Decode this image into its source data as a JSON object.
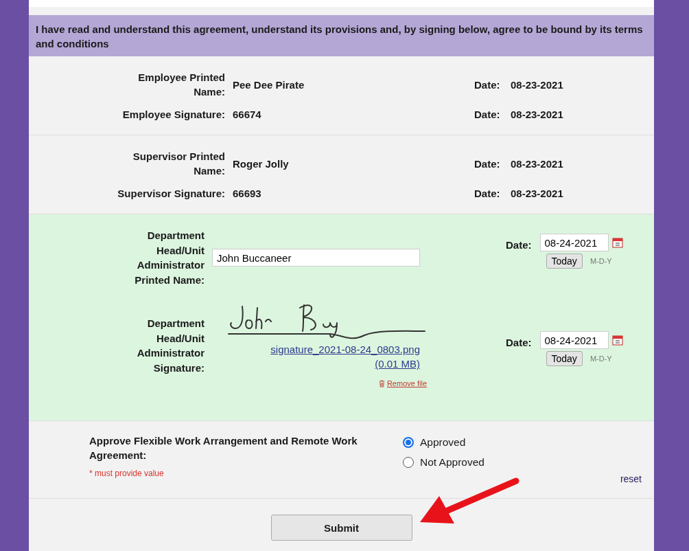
{
  "notice": "I have read and understand this agreement, understand its provisions and, by signing below, agree to be bound by its terms and conditions",
  "signoffs": [
    {
      "rows": [
        {
          "label": "Employee Printed Name:",
          "value": "Pee Dee Pirate",
          "date_label": "Date:",
          "date": "08-23-2021"
        },
        {
          "label": "Employee Signature:",
          "value": "66674",
          "date_label": "Date:",
          "date": "08-23-2021"
        }
      ]
    },
    {
      "rows": [
        {
          "label": "Supervisor Printed Name:",
          "value": "Roger Jolly",
          "date_label": "Date:",
          "date": "08-23-2021"
        },
        {
          "label": "Supervisor Signature:",
          "value": "66693",
          "date_label": "Date:",
          "date": "08-23-2021"
        }
      ]
    }
  ],
  "department_head": {
    "name_label": "Department Head/Unit Administrator Printed Name:",
    "name_value": "John Buccaneer",
    "signature_label": "Department Head/Unit Administrator Signature:",
    "signature_file": "signature_2021-08-24_0803.png",
    "file_size": "(0.01 MB)",
    "remove_label": "Remove file",
    "dates": [
      {
        "label": "Date:",
        "value": "08-24-2021",
        "today": "Today",
        "format": "M-D-Y"
      },
      {
        "label": "Date:",
        "value": "08-24-2021",
        "today": "Today",
        "format": "M-D-Y"
      }
    ]
  },
  "approval": {
    "label": "Approve Flexible Work Arrangement and Remote Work Agreement:",
    "required_note": "* must provide value",
    "options": [
      {
        "label": "Approved",
        "selected": true
      },
      {
        "label": "Not Approved",
        "selected": false
      }
    ],
    "reset": "reset"
  },
  "submit": "Submit"
}
